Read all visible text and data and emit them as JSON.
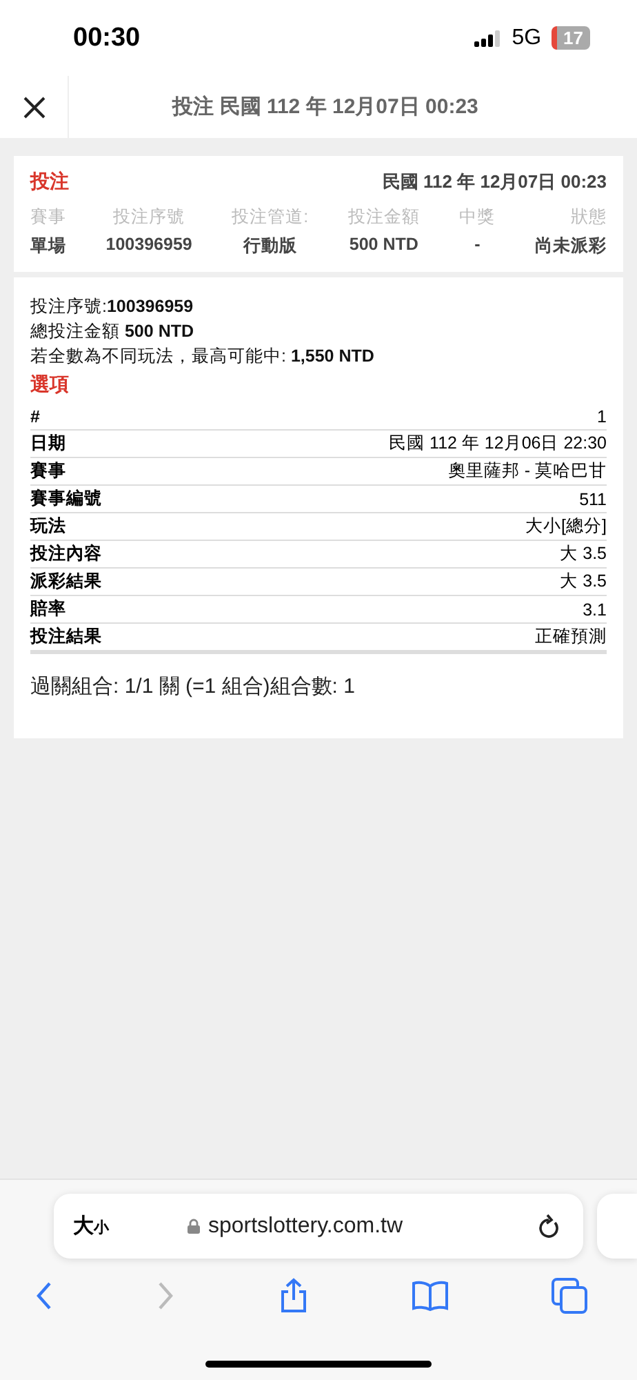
{
  "status_bar": {
    "time": "00:30",
    "network": "5G",
    "battery": "17"
  },
  "header": {
    "title": "投注 民國 112 年 12月07日 00:23"
  },
  "summary": {
    "title": "投注",
    "date": "民國 112 年 12月07日 00:23",
    "columns": [
      {
        "label": "賽事",
        "value": "單場"
      },
      {
        "label": "投注序號",
        "value": "100396959"
      },
      {
        "label": "投注管道:",
        "value": "行動版"
      },
      {
        "label": "投注金額",
        "value": "500 NTD"
      },
      {
        "label": "中獎",
        "value": "-"
      },
      {
        "label": "狀態",
        "value": "尚未派彩"
      }
    ]
  },
  "details": {
    "lines": [
      "投注序號:**100396959**",
      "總投注金額 **500 NTD**",
      "若全數為不同玩法，最高可能中: **1,550 NTD**"
    ],
    "section_title": "選項",
    "rows": [
      {
        "label": "#",
        "value": "1"
      },
      {
        "label": "日期",
        "value": "民國 112 年 12月06日 22:30"
      },
      {
        "label": "賽事",
        "value": "奧里薩邦 - 莫哈巴甘"
      },
      {
        "label": "賽事編號",
        "value": "511"
      },
      {
        "label": "玩法",
        "value": "大小[總分]"
      },
      {
        "label": "投注內容",
        "value": "大 3.5"
      },
      {
        "label": "派彩結果",
        "value": "大 3.5"
      },
      {
        "label": "賠率",
        "value": "3.1"
      },
      {
        "label": "投注結果",
        "value": "正確預測"
      }
    ],
    "footer": "過關組合: 1/1 關 (=1 組合)組合數: 1"
  },
  "browser": {
    "text_size": {
      "large": "大",
      "small": "小"
    },
    "url": "sportslottery.com.tw",
    "toolbar": [
      {
        "kind": "back",
        "disabled": false
      },
      {
        "kind": "forward",
        "disabled": true
      },
      {
        "kind": "share",
        "disabled": false
      },
      {
        "kind": "bookmarks",
        "disabled": false
      },
      {
        "kind": "tabs",
        "disabled": false
      }
    ]
  }
}
